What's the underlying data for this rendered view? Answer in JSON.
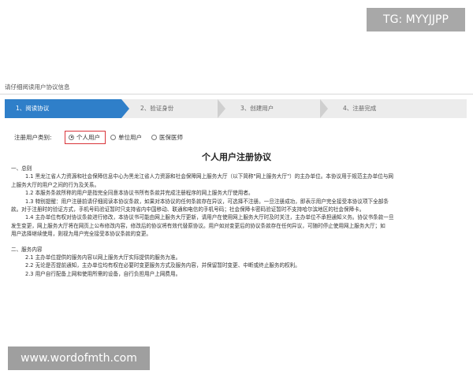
{
  "watermarks": {
    "top": "TG: MYYJJPP",
    "bottom": "www.wordofmth.com"
  },
  "header": {
    "title": "请仔细阅读用户协议信息"
  },
  "steps": [
    {
      "label": "1、阅读协议",
      "active": true
    },
    {
      "label": "2、验证身份",
      "active": false
    },
    {
      "label": "3、创建用户",
      "active": false
    },
    {
      "label": "4、注册完成",
      "active": false
    }
  ],
  "user_type": {
    "label": "注册用户类别:",
    "options": [
      {
        "label": "个人用户",
        "selected": true
      },
      {
        "label": "单位用户",
        "selected": false
      },
      {
        "label": "医保医师",
        "selected": false
      }
    ]
  },
  "agreement": {
    "title": "个人用户注册协议",
    "section1_heading": "一、总则",
    "p1_1a": "1.1 黑龙江省人力资源和社会保障信息中心为黑龙江省人力资源和社会保障网上服务大厅（以下简称\"网上服务大厅\"）的主办单位。本协议用于规范主办单位与网",
    "p1_1b": "上服务大厅的用户之间的行为及关系。",
    "p1_2": "1.2 本服务条款所称的用户是指完全同意本协议书所有条款并完成注册程序的网上服务大厅使用者。",
    "p1_3a": "1.3 特别提醒：用户注册前请仔细阅读本协议条款，如果对本协议的任何条款存在异议，可选择不注册。一旦注册成功，即表示用户完全接受本协议项下全部条",
    "p1_3b": "款。对于注册时的验证方式，手机号码验证暂时只支持省内中国移动、联通和电信的手机号码；社会保障卡密码验证暂时不支持哈尔滨地区的社会保障卡。",
    "p1_4a": "1.4 主办单位有权对协议条款进行修改，本协议书可能由网上服务大厅更新，请用户在使用网上服务大厅时及时关注，主办单位不承担通知义务。协议书条款一旦",
    "p1_4b": "发生变更，网上服务大厅将在网页上公布修改内容，修改后的协议将有效代替原协议。用户如对变更后的协议条款存在任何异议，可随时停止使用网上服务大厅；如",
    "p1_4c": "用户选择继续使用，则视为用户完全接受本协议条款的变更。",
    "section2_heading": "二、服务内容",
    "p2_1": "2.1 主办单位提供的服务内容以网上服务大厅实际提供的服务为准。",
    "p2_2": "2.2 无论是否提前通知，主办单位均有权在必要时变更服务方式及服务内容，并保留暂时变更、中断或终止服务的权利。",
    "p2_3": "2.3 用户自行配备上网和使用所需的设备，自行负担用户上网费用。"
  },
  "colors": {
    "step_active": "#2f7fc9",
    "selected_outline": "#d9343a"
  }
}
